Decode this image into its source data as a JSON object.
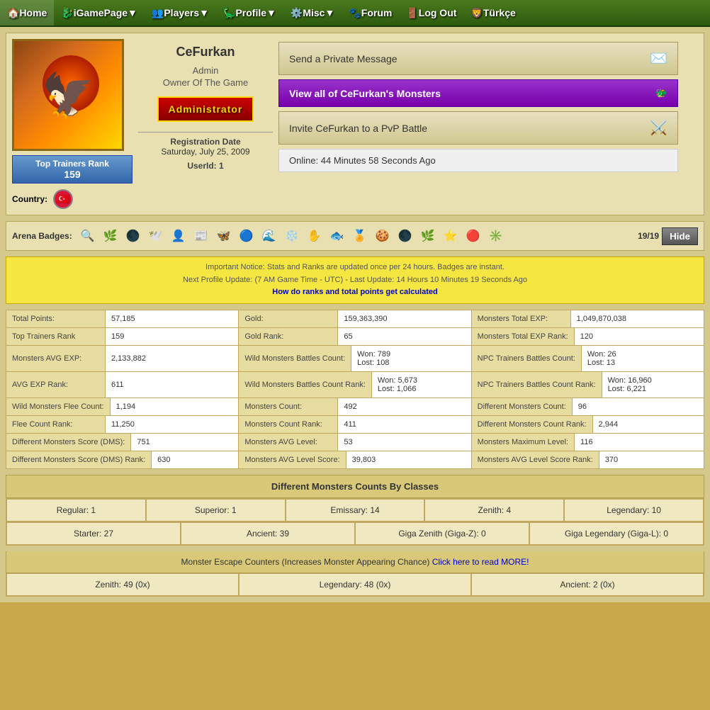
{
  "nav": {
    "items": [
      {
        "label": "Home",
        "icon": "🏠"
      },
      {
        "label": "iGamePage",
        "icon": "🐉"
      },
      {
        "label": "Players",
        "icon": "👥"
      },
      {
        "label": "Profile",
        "icon": "🦕"
      },
      {
        "label": "Misc",
        "icon": "⚙️"
      },
      {
        "label": "Forum",
        "icon": "🐾"
      },
      {
        "label": "Log Out",
        "icon": "🚪"
      },
      {
        "label": "Türkçe",
        "icon": "🦁"
      }
    ]
  },
  "profile": {
    "username": "CeFurkan",
    "role1": "Admin",
    "role2": "Owner Of The Game",
    "admin_badge": "Administrator",
    "reg_date_label": "Registration Date",
    "reg_date_value": "Saturday, July 25, 2009",
    "userid_label": "UserId:",
    "userid_value": "1",
    "country_label": "Country:",
    "top_trainers_rank_label": "Top Trainers Rank",
    "top_trainers_rank_value": "159"
  },
  "actions": {
    "send_pm_label": "Send a Private Message",
    "view_monsters_label": "View all of CeFurkan's Monsters",
    "pvp_label": "Invite CeFurkan to a PvP Battle",
    "online_label": "Online: 44 Minutes 58 Seconds Ago"
  },
  "arena_badges": {
    "label": "Arena Badges:",
    "count": "19/19",
    "hide_label": "Hide",
    "icons": [
      "🔍",
      "🌿",
      "🌑",
      "🕊️",
      "👤",
      "📰",
      "🦋",
      "🔵",
      "🌊",
      "❄️",
      "✋",
      "🐟",
      "🏅",
      "🍪",
      "🌑",
      "🌿",
      "⭐",
      "🔴",
      "✳️"
    ]
  },
  "notice": {
    "line1": "Important Notice: Stats and Ranks are updated once per 24 hours. Badges are instant.",
    "line2": "Next Profile Update: (7 AM Game Time - UTC) - Last Update: 14 Hours 10 Minutes 19 Seconds Ago",
    "link_text": "How do ranks and total points get calculated"
  },
  "stats": {
    "rows": [
      {
        "col1_label": "Total Points:",
        "col1_val": "57,185",
        "col2_label": "Gold:",
        "col2_val": "159,363,390",
        "col3_label": "Monsters Total EXP:",
        "col3_val": "1,049,870,038"
      },
      {
        "col1_label": "Top Trainers Rank",
        "col1_val": "159",
        "col2_label": "Gold Rank:",
        "col2_val": "65",
        "col3_label": "Monsters Total EXP Rank:",
        "col3_val": "120"
      },
      {
        "col1_label": "Monsters AVG EXP:",
        "col1_val": "2,133,882",
        "col2_label": "Wild Monsters Battles Count:",
        "col2_val": "Won: 789\nLost: 108",
        "col3_label": "NPC Trainers Battles Count:",
        "col3_val": "Won: 26\nLost: 13"
      },
      {
        "col1_label": "AVG EXP Rank:",
        "col1_val": "611",
        "col2_label": "Wild Monsters Battles Count Rank:",
        "col2_val": "Won: 5,673\nLost: 1,066",
        "col3_label": "NPC Trainers Battles Count Rank:",
        "col3_val": "Won: 16,960\nLost: 6,221"
      },
      {
        "col1_label": "Wild Monsters Flee Count:",
        "col1_val": "1,194",
        "col2_label": "Monsters Count:",
        "col2_val": "492",
        "col3_label": "Different Monsters Count:",
        "col3_val": "96"
      },
      {
        "col1_label": "Flee Count Rank:",
        "col1_val": "11,250",
        "col2_label": "Monsters Count Rank:",
        "col2_val": "411",
        "col3_label": "Different Monsters Count Rank:",
        "col3_val": "2,944"
      },
      {
        "col1_label": "Different Monsters Score (DMS):",
        "col1_val": "751",
        "col2_label": "Monsters AVG Level:",
        "col2_val": "53",
        "col3_label": "Monsters Maximum Level:",
        "col3_val": "116"
      },
      {
        "col1_label": "Different Monsters Score (DMS) Rank:",
        "col1_val": "630",
        "col2_label": "Monsters AVG Level Score:",
        "col2_val": "39,803",
        "col3_label": "Monsters AVG Level Score Rank:",
        "col3_val": "370"
      }
    ]
  },
  "diff_monsters": {
    "section_label": "Different Monsters Counts By Classes",
    "row1": [
      {
        "label": "Regular: 1"
      },
      {
        "label": "Superior: 1"
      },
      {
        "label": "Emissary: 14"
      },
      {
        "label": "Zenith: 4"
      },
      {
        "label": "Legendary: 10"
      }
    ],
    "row2": [
      {
        "label": "Starter: 27"
      },
      {
        "label": "Ancient: 39"
      },
      {
        "label": "Giga Zenith (Giga-Z): 0"
      },
      {
        "label": "Giga Legendary (Giga-L): 0"
      }
    ]
  },
  "escape_counters": {
    "label": "Monster Escape Counters (Increases Monster Appearing Chance)",
    "link": "Click here to read MORE!",
    "rows": [
      {
        "label": "Zenith: 49 (0x)"
      },
      {
        "label": "Legendary: 48 (0x)"
      },
      {
        "label": "Ancient: 2 (0x)"
      }
    ]
  }
}
